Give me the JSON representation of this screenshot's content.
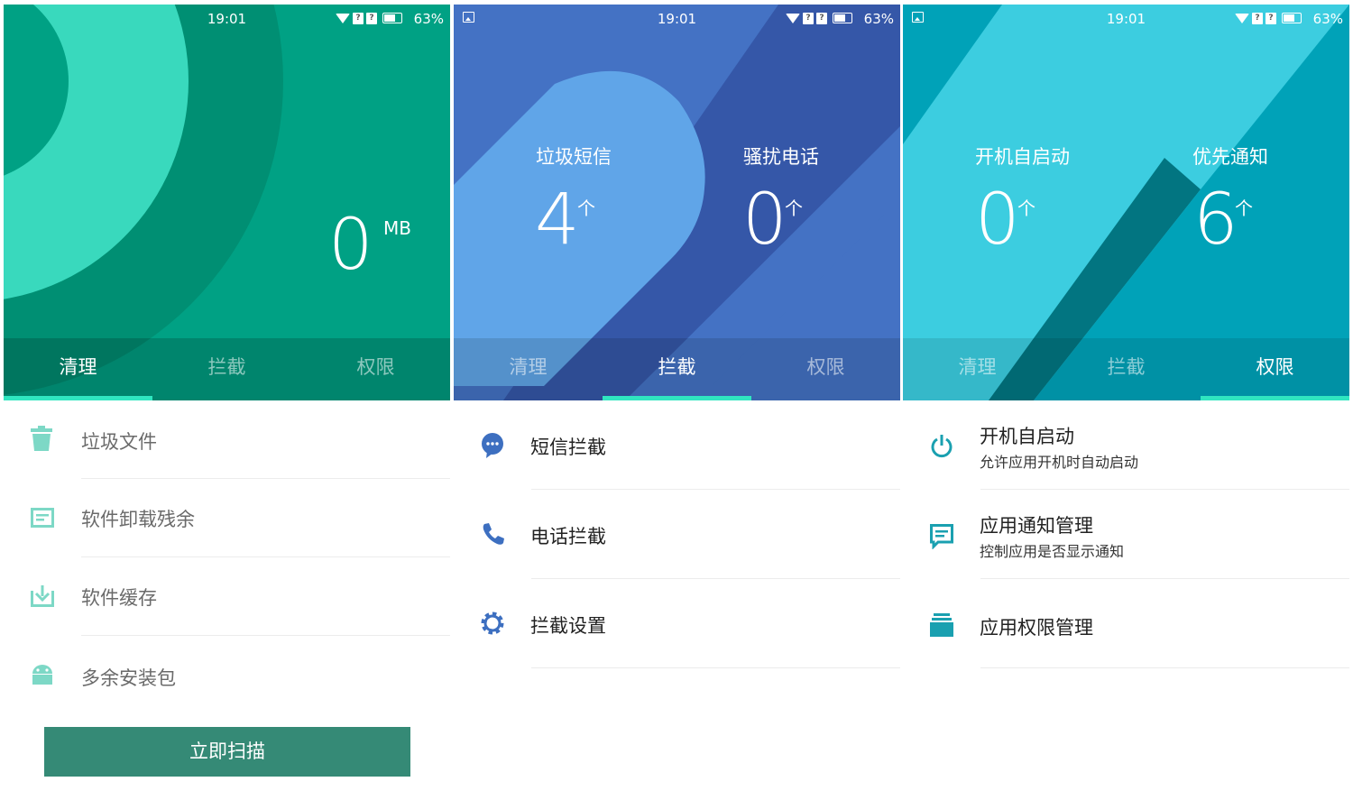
{
  "status": {
    "time": "19:01",
    "battery": "63%"
  },
  "tabs": [
    "清理",
    "拦截",
    "权限"
  ],
  "colors": {
    "clean_theme": "#00a184",
    "block_theme": "#4472c4",
    "perm_theme": "#00a2b8",
    "tab_indicator": "#30e6c0",
    "scan_button": "#358a76"
  },
  "clean": {
    "size_value": "0",
    "size_unit": "MB",
    "items": [
      {
        "icon": "trash-icon",
        "label": "垃圾文件"
      },
      {
        "icon": "note-icon",
        "label": "软件卸载残余"
      },
      {
        "icon": "download-icon",
        "label": "软件缓存"
      },
      {
        "icon": "android-icon",
        "label": "多余安装包"
      }
    ],
    "scan_button": "立即扫描"
  },
  "block": {
    "stats": [
      {
        "label": "垃圾短信",
        "value": "4",
        "unit": "个"
      },
      {
        "label": "骚扰电话",
        "value": "0",
        "unit": "个"
      }
    ],
    "items": [
      {
        "icon": "chat-bubble-icon",
        "label": "短信拦截"
      },
      {
        "icon": "phone-icon",
        "label": "电话拦截"
      },
      {
        "icon": "gear-icon",
        "label": "拦截设置"
      }
    ]
  },
  "perm": {
    "stats": [
      {
        "label": "开机自启动",
        "value": "0",
        "unit": "个"
      },
      {
        "label": "优先通知",
        "value": "6",
        "unit": "个"
      }
    ],
    "items": [
      {
        "icon": "power-icon",
        "label": "开机自启动",
        "sub": "允许应用开机时自动启动"
      },
      {
        "icon": "message-icon",
        "label": "应用通知管理",
        "sub": "控制应用是否显示通知"
      },
      {
        "icon": "stack-icon",
        "label": "应用权限管理",
        "sub": ""
      }
    ]
  }
}
